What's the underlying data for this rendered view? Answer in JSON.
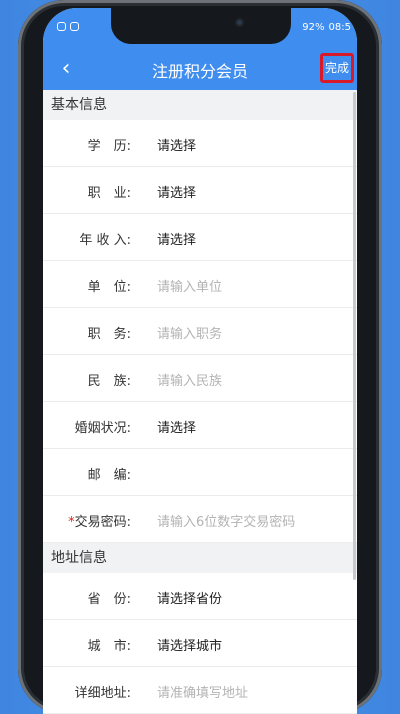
{
  "status": {
    "battery": "92%",
    "time": "08:5"
  },
  "nav": {
    "back": "‹",
    "title": "注册积分会员",
    "done": "完成"
  },
  "sections": [
    {
      "title": "基本信息",
      "rows": [
        {
          "label": "学　历:",
          "value": "请选择",
          "placeholder": false
        },
        {
          "label": "职　业:",
          "value": "请选择",
          "placeholder": false
        },
        {
          "label": "年 收 入:",
          "value": "请选择",
          "placeholder": false
        },
        {
          "label": "单　位:",
          "value": "请输入单位",
          "placeholder": true
        },
        {
          "label": "职　务:",
          "value": "请输入职务",
          "placeholder": true
        },
        {
          "label": "民　族:",
          "value": "请输入民族",
          "placeholder": true
        },
        {
          "label": "婚姻状况:",
          "value": "请选择",
          "placeholder": false
        },
        {
          "label": "邮　编:",
          "value": "",
          "placeholder": true
        },
        {
          "label": "交易密码:",
          "value": "请输入6位数字交易密码",
          "placeholder": true,
          "required": "*"
        }
      ]
    },
    {
      "title": "地址信息",
      "rows": [
        {
          "label": "省　份:",
          "value": "请选择省份",
          "placeholder": false
        },
        {
          "label": "城　市:",
          "value": "请选择城市",
          "placeholder": false
        },
        {
          "label": "详细地址:",
          "value": "请准确填写地址",
          "placeholder": true
        }
      ]
    }
  ]
}
